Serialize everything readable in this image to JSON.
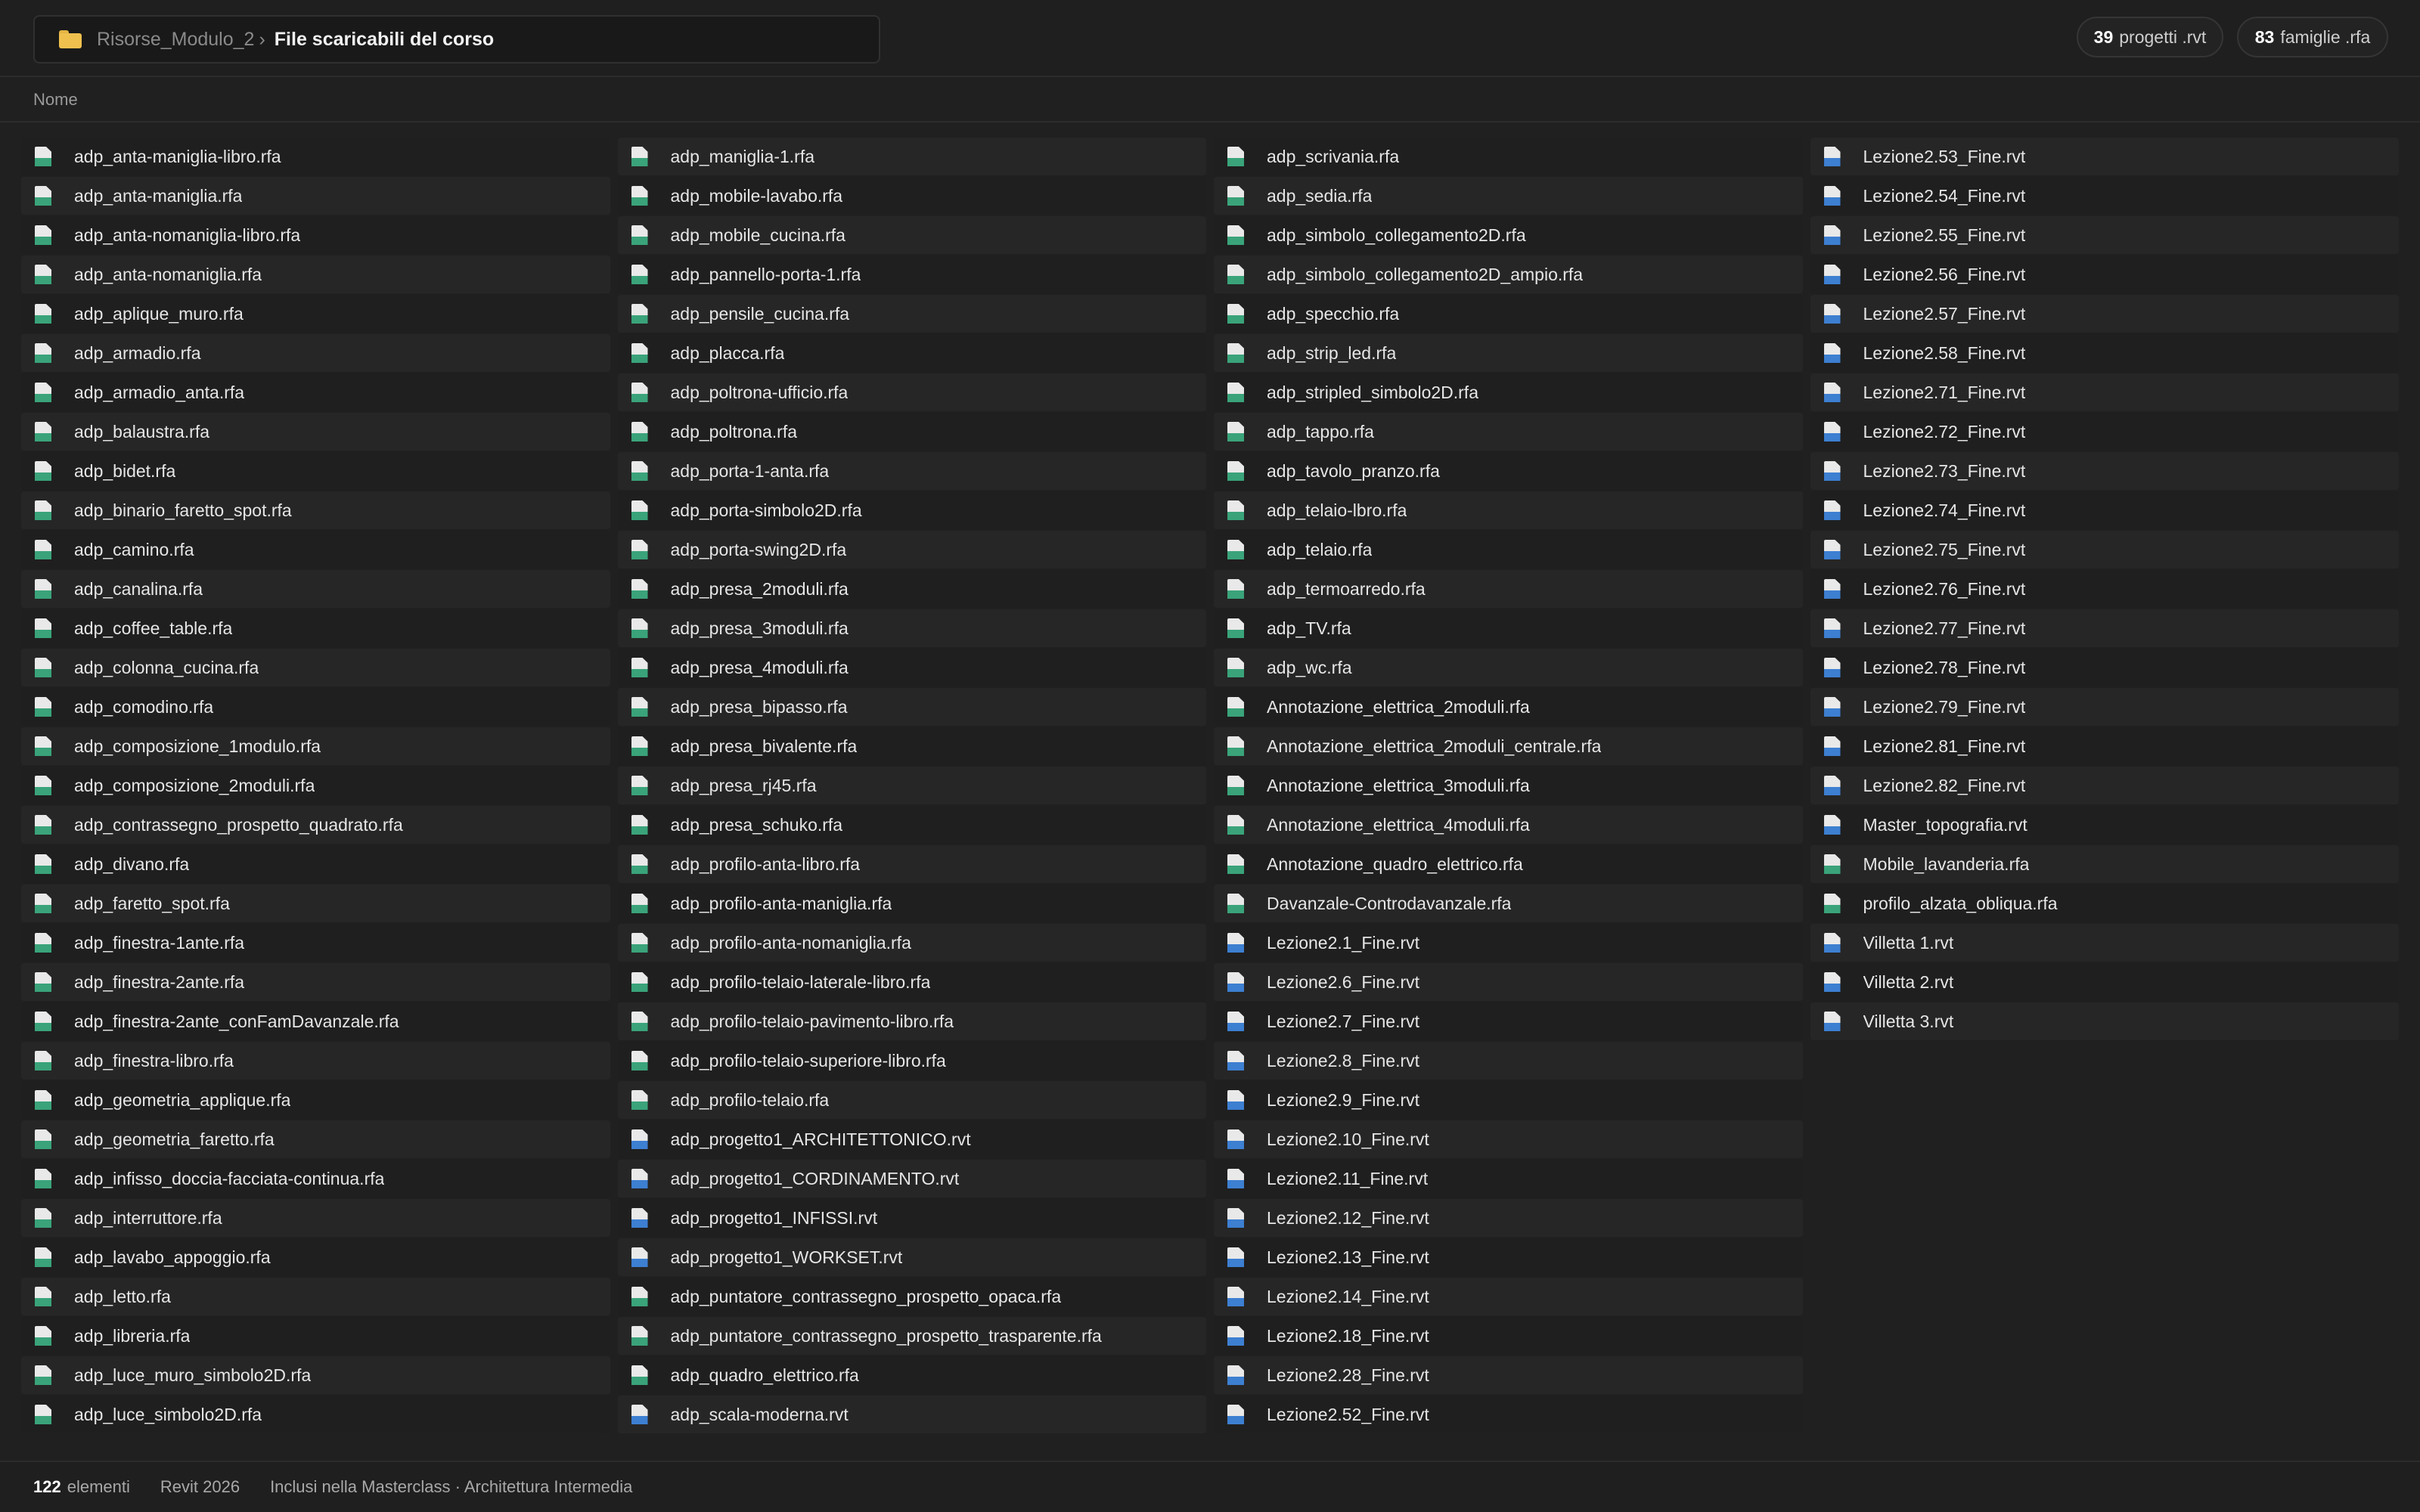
{
  "breadcrumb": {
    "parent": "Risorse_Modulo_2",
    "separator": "›",
    "current": "File scaricabili del corso"
  },
  "stats": {
    "rvt_count": "39",
    "rvt_label": "progetti .rvt",
    "rfa_count": "83",
    "rfa_label": "famiglie .rfa"
  },
  "column_header": "Nome",
  "files": [
    {
      "name": "adp_anta-maniglia-libro.rfa",
      "type": "rfa"
    },
    {
      "name": "adp_anta-maniglia.rfa",
      "type": "rfa"
    },
    {
      "name": "adp_anta-nomaniglia-libro.rfa",
      "type": "rfa"
    },
    {
      "name": "adp_anta-nomaniglia.rfa",
      "type": "rfa"
    },
    {
      "name": "adp_aplique_muro.rfa",
      "type": "rfa"
    },
    {
      "name": "adp_armadio.rfa",
      "type": "rfa"
    },
    {
      "name": "adp_armadio_anta.rfa",
      "type": "rfa"
    },
    {
      "name": "adp_balaustra.rfa",
      "type": "rfa"
    },
    {
      "name": "adp_bidet.rfa",
      "type": "rfa"
    },
    {
      "name": "adp_binario_faretto_spot.rfa",
      "type": "rfa"
    },
    {
      "name": "adp_camino.rfa",
      "type": "rfa"
    },
    {
      "name": "adp_canalina.rfa",
      "type": "rfa"
    },
    {
      "name": "adp_coffee_table.rfa",
      "type": "rfa"
    },
    {
      "name": "adp_colonna_cucina.rfa",
      "type": "rfa"
    },
    {
      "name": "adp_comodino.rfa",
      "type": "rfa"
    },
    {
      "name": "adp_composizione_1modulo.rfa",
      "type": "rfa"
    },
    {
      "name": "adp_composizione_2moduli.rfa",
      "type": "rfa"
    },
    {
      "name": "adp_contrassegno_prospetto_quadrato.rfa",
      "type": "rfa"
    },
    {
      "name": "adp_divano.rfa",
      "type": "rfa"
    },
    {
      "name": "adp_faretto_spot.rfa",
      "type": "rfa"
    },
    {
      "name": "adp_finestra-1ante.rfa",
      "type": "rfa"
    },
    {
      "name": "adp_finestra-2ante.rfa",
      "type": "rfa"
    },
    {
      "name": "adp_finestra-2ante_conFamDavanzale.rfa",
      "type": "rfa"
    },
    {
      "name": "adp_finestra-libro.rfa",
      "type": "rfa"
    },
    {
      "name": "adp_geometria_applique.rfa",
      "type": "rfa"
    },
    {
      "name": "adp_geometria_faretto.rfa",
      "type": "rfa"
    },
    {
      "name": "adp_infisso_doccia-facciata-continua.rfa",
      "type": "rfa"
    },
    {
      "name": "adp_interruttore.rfa",
      "type": "rfa"
    },
    {
      "name": "adp_lavabo_appoggio.rfa",
      "type": "rfa"
    },
    {
      "name": "adp_letto.rfa",
      "type": "rfa"
    },
    {
      "name": "adp_libreria.rfa",
      "type": "rfa"
    },
    {
      "name": "adp_luce_muro_simbolo2D.rfa",
      "type": "rfa"
    },
    {
      "name": "adp_luce_simbolo2D.rfa",
      "type": "rfa"
    },
    {
      "name": "adp_maniglia-1.rfa",
      "type": "rfa"
    },
    {
      "name": "adp_mobile-lavabo.rfa",
      "type": "rfa"
    },
    {
      "name": "adp_mobile_cucina.rfa",
      "type": "rfa"
    },
    {
      "name": "adp_pannello-porta-1.rfa",
      "type": "rfa"
    },
    {
      "name": "adp_pensile_cucina.rfa",
      "type": "rfa"
    },
    {
      "name": "adp_placca.rfa",
      "type": "rfa"
    },
    {
      "name": "adp_poltrona-ufficio.rfa",
      "type": "rfa"
    },
    {
      "name": "adp_poltrona.rfa",
      "type": "rfa"
    },
    {
      "name": "adp_porta-1-anta.rfa",
      "type": "rfa"
    },
    {
      "name": "adp_porta-simbolo2D.rfa",
      "type": "rfa"
    },
    {
      "name": "adp_porta-swing2D.rfa",
      "type": "rfa"
    },
    {
      "name": "adp_presa_2moduli.rfa",
      "type": "rfa"
    },
    {
      "name": "adp_presa_3moduli.rfa",
      "type": "rfa"
    },
    {
      "name": "adp_presa_4moduli.rfa",
      "type": "rfa"
    },
    {
      "name": "adp_presa_bipasso.rfa",
      "type": "rfa"
    },
    {
      "name": "adp_presa_bivalente.rfa",
      "type": "rfa"
    },
    {
      "name": "adp_presa_rj45.rfa",
      "type": "rfa"
    },
    {
      "name": "adp_presa_schuko.rfa",
      "type": "rfa"
    },
    {
      "name": "adp_profilo-anta-libro.rfa",
      "type": "rfa"
    },
    {
      "name": "adp_profilo-anta-maniglia.rfa",
      "type": "rfa"
    },
    {
      "name": "adp_profilo-anta-nomaniglia.rfa",
      "type": "rfa"
    },
    {
      "name": "adp_profilo-telaio-laterale-libro.rfa",
      "type": "rfa"
    },
    {
      "name": "adp_profilo-telaio-pavimento-libro.rfa",
      "type": "rfa"
    },
    {
      "name": "adp_profilo-telaio-superiore-libro.rfa",
      "type": "rfa"
    },
    {
      "name": "adp_profilo-telaio.rfa",
      "type": "rfa"
    },
    {
      "name": "adp_progetto1_ARCHITETTONICO.rvt",
      "type": "rvt"
    },
    {
      "name": "adp_progetto1_CORDINAMENTO.rvt",
      "type": "rvt"
    },
    {
      "name": "adp_progetto1_INFISSI.rvt",
      "type": "rvt"
    },
    {
      "name": "adp_progetto1_WORKSET.rvt",
      "type": "rvt"
    },
    {
      "name": "adp_puntatore_contrassegno_prospetto_opaca.rfa",
      "type": "rfa"
    },
    {
      "name": "adp_puntatore_contrassegno_prospetto_trasparente.rfa",
      "type": "rfa"
    },
    {
      "name": "adp_quadro_elettrico.rfa",
      "type": "rfa"
    },
    {
      "name": "adp_scala-moderna.rvt",
      "type": "rvt"
    },
    {
      "name": "adp_scrivania.rfa",
      "type": "rfa"
    },
    {
      "name": "adp_sedia.rfa",
      "type": "rfa"
    },
    {
      "name": "adp_simbolo_collegamento2D.rfa",
      "type": "rfa"
    },
    {
      "name": "adp_simbolo_collegamento2D_ampio.rfa",
      "type": "rfa"
    },
    {
      "name": "adp_specchio.rfa",
      "type": "rfa"
    },
    {
      "name": "adp_strip_led.rfa",
      "type": "rfa"
    },
    {
      "name": "adp_stripled_simbolo2D.rfa",
      "type": "rfa"
    },
    {
      "name": "adp_tappo.rfa",
      "type": "rfa"
    },
    {
      "name": "adp_tavolo_pranzo.rfa",
      "type": "rfa"
    },
    {
      "name": "adp_telaio-lbro.rfa",
      "type": "rfa"
    },
    {
      "name": "adp_telaio.rfa",
      "type": "rfa"
    },
    {
      "name": "adp_termoarredo.rfa",
      "type": "rfa"
    },
    {
      "name": "adp_TV.rfa",
      "type": "rfa"
    },
    {
      "name": "adp_wc.rfa",
      "type": "rfa"
    },
    {
      "name": "Annotazione_elettrica_2moduli.rfa",
      "type": "rfa"
    },
    {
      "name": "Annotazione_elettrica_2moduli_centrale.rfa",
      "type": "rfa"
    },
    {
      "name": "Annotazione_elettrica_3moduli.rfa",
      "type": "rfa"
    },
    {
      "name": "Annotazione_elettrica_4moduli.rfa",
      "type": "rfa"
    },
    {
      "name": "Annotazione_quadro_elettrico.rfa",
      "type": "rfa"
    },
    {
      "name": "Davanzale-Controdavanzale.rfa",
      "type": "rfa"
    },
    {
      "name": "Lezione2.1_Fine.rvt",
      "type": "rvt"
    },
    {
      "name": "Lezione2.6_Fine.rvt",
      "type": "rvt"
    },
    {
      "name": "Lezione2.7_Fine.rvt",
      "type": "rvt"
    },
    {
      "name": "Lezione2.8_Fine.rvt",
      "type": "rvt"
    },
    {
      "name": "Lezione2.9_Fine.rvt",
      "type": "rvt"
    },
    {
      "name": "Lezione2.10_Fine.rvt",
      "type": "rvt"
    },
    {
      "name": "Lezione2.11_Fine.rvt",
      "type": "rvt"
    },
    {
      "name": "Lezione2.12_Fine.rvt",
      "type": "rvt"
    },
    {
      "name": "Lezione2.13_Fine.rvt",
      "type": "rvt"
    },
    {
      "name": "Lezione2.14_Fine.rvt",
      "type": "rvt"
    },
    {
      "name": "Lezione2.18_Fine.rvt",
      "type": "rvt"
    },
    {
      "name": "Lezione2.28_Fine.rvt",
      "type": "rvt"
    },
    {
      "name": "Lezione2.52_Fine.rvt",
      "type": "rvt"
    },
    {
      "name": "Lezione2.53_Fine.rvt",
      "type": "rvt"
    },
    {
      "name": "Lezione2.54_Fine.rvt",
      "type": "rvt"
    },
    {
      "name": "Lezione2.55_Fine.rvt",
      "type": "rvt"
    },
    {
      "name": "Lezione2.56_Fine.rvt",
      "type": "rvt"
    },
    {
      "name": "Lezione2.57_Fine.rvt",
      "type": "rvt"
    },
    {
      "name": "Lezione2.58_Fine.rvt",
      "type": "rvt"
    },
    {
      "name": "Lezione2.71_Fine.rvt",
      "type": "rvt"
    },
    {
      "name": "Lezione2.72_Fine.rvt",
      "type": "rvt"
    },
    {
      "name": "Lezione2.73_Fine.rvt",
      "type": "rvt"
    },
    {
      "name": "Lezione2.74_Fine.rvt",
      "type": "rvt"
    },
    {
      "name": "Lezione2.75_Fine.rvt",
      "type": "rvt"
    },
    {
      "name": "Lezione2.76_Fine.rvt",
      "type": "rvt"
    },
    {
      "name": "Lezione2.77_Fine.rvt",
      "type": "rvt"
    },
    {
      "name": "Lezione2.78_Fine.rvt",
      "type": "rvt"
    },
    {
      "name": "Lezione2.79_Fine.rvt",
      "type": "rvt"
    },
    {
      "name": "Lezione2.81_Fine.rvt",
      "type": "rvt"
    },
    {
      "name": "Lezione2.82_Fine.rvt",
      "type": "rvt"
    },
    {
      "name": "Master_topografia.rvt",
      "type": "rvt"
    },
    {
      "name": "Mobile_lavanderia.rfa",
      "type": "rfa"
    },
    {
      "name": "profilo_alzata_obliqua.rfa",
      "type": "rfa"
    },
    {
      "name": "Villetta 1.rvt",
      "type": "rvt"
    },
    {
      "name": "Villetta 2.rvt",
      "type": "rvt"
    },
    {
      "name": "Villetta 3.rvt",
      "type": "rvt"
    }
  ],
  "footer": {
    "count": "122",
    "count_label": "elementi",
    "version": "Revit 2026",
    "note": "Inclusi nella Masterclass · Architettura Intermedia"
  }
}
